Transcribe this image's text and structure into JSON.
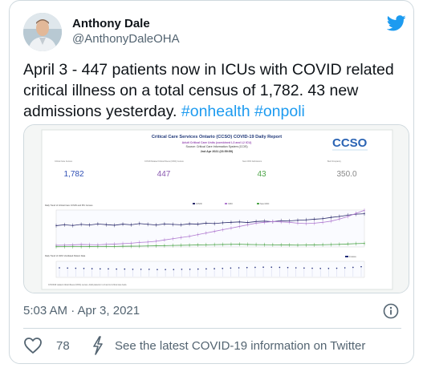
{
  "author": {
    "name": "Anthony Dale",
    "handle": "@AnthonyDaleOHA"
  },
  "tweet": {
    "text_parts": {
      "line1": "April 3 - 447 patients now in ICUs with COVID related",
      "line2": "critical illness on a total census of 1,782. 43 new",
      "line3_prefix": "admissions yesterday. ",
      "hashtag1": "#onhealth",
      "space": " ",
      "hashtag2": "#onpoli"
    },
    "timestamp": "5:03 AM · Apr 3, 2021",
    "likes": "78",
    "covid_link": "See the latest COVID-19 information on Twitter"
  },
  "media": {
    "title": "Critical Care Services Ontario (CCSO) COVID-19 Daily Report",
    "subtitle1": "Adult Critical Care Units (combined L3 and L2 ICU)",
    "subtitle2": "Source: Critical Care Information System (CCIS)",
    "subtitle3": "2nd Apr 2021 (23:59:59)",
    "logo": "CCSO",
    "stats": [
      {
        "label": "Critical Care Census",
        "value": "1,782",
        "color": "#2f4fb5"
      },
      {
        "label": "COVID Related Critical Illness (CRCI) Census",
        "value": "447",
        "color": "#8a5ab0"
      },
      {
        "label": "New CRCI Admissions",
        "value": "43",
        "color": "#4fa64a"
      },
      {
        "label": "Bed Occupancy",
        "value": "350.0",
        "color": "#888888"
      }
    ],
    "chart_data": [
      {
        "type": "line",
        "title": "Daily Trend of Critical Care COVID and PIU Census",
        "series": [
          {
            "name": "COVID",
            "color": "#2b2b6b",
            "values": [
              260,
              270,
              262,
              275,
              268,
              280,
              272,
              265,
              278,
              270,
              285,
              276,
              268,
              280,
              275,
              270,
              282,
              278,
              290,
              285,
              295,
              300,
              305,
              298,
              310,
              315,
              308,
              320,
              318,
              325,
              330,
              338,
              345,
              360,
              372,
              388,
              400,
              405
            ]
          },
          {
            "name": "CRCI",
            "color": "#b07ad0",
            "values": [
              20,
              22,
              25,
              30,
              28,
              26,
              32,
              35,
              40,
              45,
              55,
              60,
              70,
              85,
              100,
              115,
              130,
              150,
              170,
              190,
              210,
              230,
              250,
              270,
              290,
              300,
              310,
              305,
              300,
              290,
              285,
              290,
              300,
              315,
              340,
              370,
              410,
              447
            ]
          },
          {
            "name": "New CRCI",
            "color": "#4fa64a",
            "values": [
              3,
              4,
              5,
              4,
              6,
              5,
              7,
              6,
              8,
              9,
              10,
              12,
              14,
              16,
              18,
              20,
              22,
              25,
              26,
              28,
              30,
              32,
              33,
              30,
              28,
              27,
              26,
              25,
              24,
              22,
              23,
              25,
              27,
              29,
              32,
              36,
              40,
              43
            ]
          }
        ]
      },
      {
        "type": "bar",
        "title": "Daily Trend of CRCI Ventilated Patient Data",
        "series": [
          {
            "name": "Invasive",
            "color": "#1e2a78",
            "values": [
              45,
              44,
              43,
              42,
              41,
              40,
              40,
              39,
              39,
              38,
              38,
              38,
              37,
              37,
              37,
              38,
              38,
              39,
              40,
              41,
              42,
              44,
              45,
              46,
              47,
              48,
              48,
              47,
              46,
              45,
              44,
              43,
              42,
              42,
              43,
              45,
              47,
              50
            ]
          }
        ]
      }
    ],
    "footnote": "COVID19 related critical illness (CRCI) census. Adult patients in L3 and L2 critical care beds."
  },
  "colors": {
    "accent": "#1d9bf0",
    "text": "#0f1419",
    "muted": "#536471"
  }
}
